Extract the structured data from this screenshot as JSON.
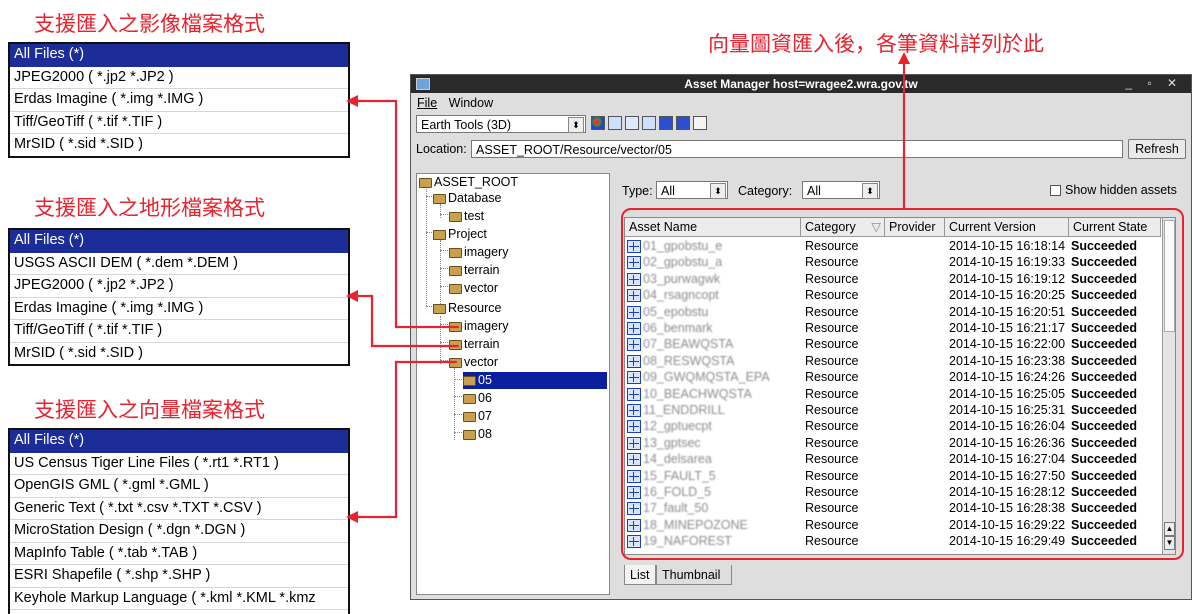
{
  "annotations": {
    "image_formats_title": "支援匯入之影像檔案格式",
    "terrain_formats_title": "支援匯入之地形檔案格式",
    "vector_formats_title": "支援匯入之向量檔案格式",
    "vector_note": "向量圖資匯入後，各筆資料詳列於此"
  },
  "image_formats": [
    "All Files (*)",
    "JPEG2000 ( *.jp2 *.JP2 )",
    "Erdas Imagine ( *.img *.IMG )",
    "Tiff/GeoTiff ( *.tif *.TIF )",
    "MrSID ( *.sid *.SID )"
  ],
  "terrain_formats": [
    "All Files (*)",
    "USGS ASCII DEM ( *.dem *.DEM )",
    "JPEG2000 ( *.jp2 *.JP2 )",
    "Erdas Imagine ( *.img *.IMG )",
    "Tiff/GeoTiff ( *.tif *.TIF )",
    "MrSID ( *.sid *.SID )"
  ],
  "vector_formats": [
    "All Files (*)",
    "US Census Tiger Line Files ( *.rt1 *.RT1 )",
    "OpenGIS GML ( *.gml *.GML )",
    "Generic Text ( *.txt *.csv *.TXT *.CSV )",
    "MicroStation Design ( *.dgn *.DGN )",
    "MapInfo Table ( *.tab *.TAB )",
    "ESRI Shapefile ( *.shp *.SHP )",
    "Keyhole Markup Language ( *.kml *.KML *.kmz"
  ],
  "window": {
    "title": "Asset Manager  host=wragee2.wra.gov.tw",
    "controls": "_ ▫ ✕",
    "menu_file": "File",
    "menu_window": "Window",
    "tool_select": "Earth Tools (3D)",
    "location_label": "Location:",
    "location_value": "ASSET_ROOT/Resource/vector/05",
    "refresh": "Refresh"
  },
  "tree": {
    "root": "ASSET_ROOT",
    "database": "Database",
    "test": "test",
    "project": "Project",
    "p_imagery": "imagery",
    "p_terrain": "terrain",
    "p_vector": "vector",
    "resource": "Resource",
    "r_imagery": "imagery",
    "r_terrain": "terrain",
    "r_vector": "vector",
    "v05": "05",
    "v06": "06",
    "v07": "07",
    "v08": "08"
  },
  "filters": {
    "type_label": "Type:",
    "type_value": "All",
    "category_label": "Category:",
    "category_value": "All",
    "hidden_label": "Show hidden assets"
  },
  "table": {
    "headers": [
      "Asset Name",
      "Category",
      "Provider",
      "Current Version",
      "Current State"
    ],
    "rows": [
      {
        "name": "01_gpobstu_e",
        "category": "Resource",
        "version": "2014-10-15 16:18:14",
        "state": "Succeeded"
      },
      {
        "name": "02_gpobstu_a",
        "category": "Resource",
        "version": "2014-10-15 16:19:33",
        "state": "Succeeded"
      },
      {
        "name": "03_purwagwk",
        "category": "Resource",
        "version": "2014-10-15 16:19:12",
        "state": "Succeeded"
      },
      {
        "name": "04_rsagncopt",
        "category": "Resource",
        "version": "2014-10-15 16:20:25",
        "state": "Succeeded"
      },
      {
        "name": "05_epobstu",
        "category": "Resource",
        "version": "2014-10-15 16:20:51",
        "state": "Succeeded"
      },
      {
        "name": "06_benmark",
        "category": "Resource",
        "version": "2014-10-15 16:21:17",
        "state": "Succeeded"
      },
      {
        "name": "07_BEAWQSTA",
        "category": "Resource",
        "version": "2014-10-15 16:22:00",
        "state": "Succeeded"
      },
      {
        "name": "08_RESWQSTA",
        "category": "Resource",
        "version": "2014-10-15 16:23:38",
        "state": "Succeeded"
      },
      {
        "name": "09_GWQMQSTA_EPA",
        "category": "Resource",
        "version": "2014-10-15 16:24:26",
        "state": "Succeeded"
      },
      {
        "name": "10_BEACHWQSTA",
        "category": "Resource",
        "version": "2014-10-15 16:25:05",
        "state": "Succeeded"
      },
      {
        "name": "11_ENDDRILL",
        "category": "Resource",
        "version": "2014-10-15 16:25:31",
        "state": "Succeeded"
      },
      {
        "name": "12_gptuecpt",
        "category": "Resource",
        "version": "2014-10-15 16:26:04",
        "state": "Succeeded"
      },
      {
        "name": "13_gptsec",
        "category": "Resource",
        "version": "2014-10-15 16:26:36",
        "state": "Succeeded"
      },
      {
        "name": "14_delsarea",
        "category": "Resource",
        "version": "2014-10-15 16:27:04",
        "state": "Succeeded"
      },
      {
        "name": "15_FAULT_5",
        "category": "Resource",
        "version": "2014-10-15 16:27:50",
        "state": "Succeeded"
      },
      {
        "name": "16_FOLD_5",
        "category": "Resource",
        "version": "2014-10-15 16:28:12",
        "state": "Succeeded"
      },
      {
        "name": "17_fault_50",
        "category": "Resource",
        "version": "2014-10-15 16:28:38",
        "state": "Succeeded"
      },
      {
        "name": "18_MINEPOZONE",
        "category": "Resource",
        "version": "2014-10-15 16:29:22",
        "state": "Succeeded"
      },
      {
        "name": "19_NAFOREST",
        "category": "Resource",
        "version": "2014-10-15 16:29:49",
        "state": "Succeeded"
      }
    ]
  },
  "tabs": [
    "List",
    "Thumbnail"
  ],
  "colors": {
    "accent_red": "#e8222e",
    "selection_blue": "#1c2d9a"
  }
}
